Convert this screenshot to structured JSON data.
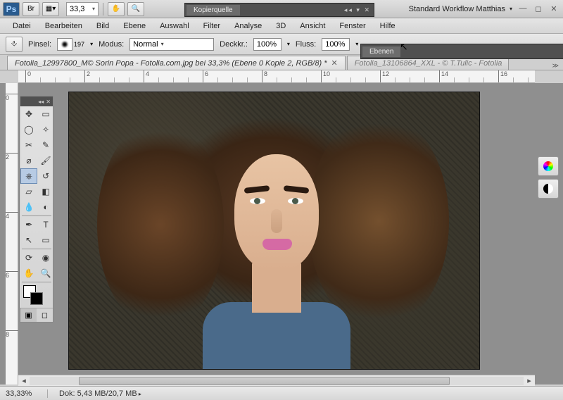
{
  "app": {
    "ps_label": "Ps",
    "br_label": "Br",
    "zoom_combo": "33,3",
    "workspace": "Standard Workflow Matthias"
  },
  "panels": {
    "kopierquelle": "Kopierquelle",
    "ebenen": "Ebenen"
  },
  "menu": [
    "Datei",
    "Bearbeiten",
    "Bild",
    "Ebene",
    "Auswahl",
    "Filter",
    "Analyse",
    "3D",
    "Ansicht",
    "Fenster",
    "Hilfe"
  ],
  "options": {
    "pinsel_label": "Pinsel:",
    "brush_size": "197",
    "modus_label": "Modus:",
    "modus_value": "Normal",
    "deckkr_label": "Deckkr.:",
    "deckkr_value": "100%",
    "fluss_label": "Fluss:",
    "fluss_value": "100%"
  },
  "tabs": [
    {
      "title": "Fotolia_12997800_M© Sorin Popa - Fotolia.com.jpg bei 33,3% (Ebene 0 Kopie 2, RGB/8) *",
      "active": true
    },
    {
      "title": "Fotolia_13106864_XXL - © T.Tulic - Fotolia",
      "active": false
    }
  ],
  "ruler_h": [
    "0",
    "2",
    "4",
    "6",
    "8",
    "10",
    "12",
    "14",
    "16"
  ],
  "ruler_v": [
    "0",
    "2",
    "4",
    "6",
    "8"
  ],
  "status": {
    "zoom": "33,33%",
    "doc": "Dok: 5,43 MB/20,7 MB"
  },
  "swatch": {
    "fg": "#ffffff",
    "bg": "#000000"
  }
}
